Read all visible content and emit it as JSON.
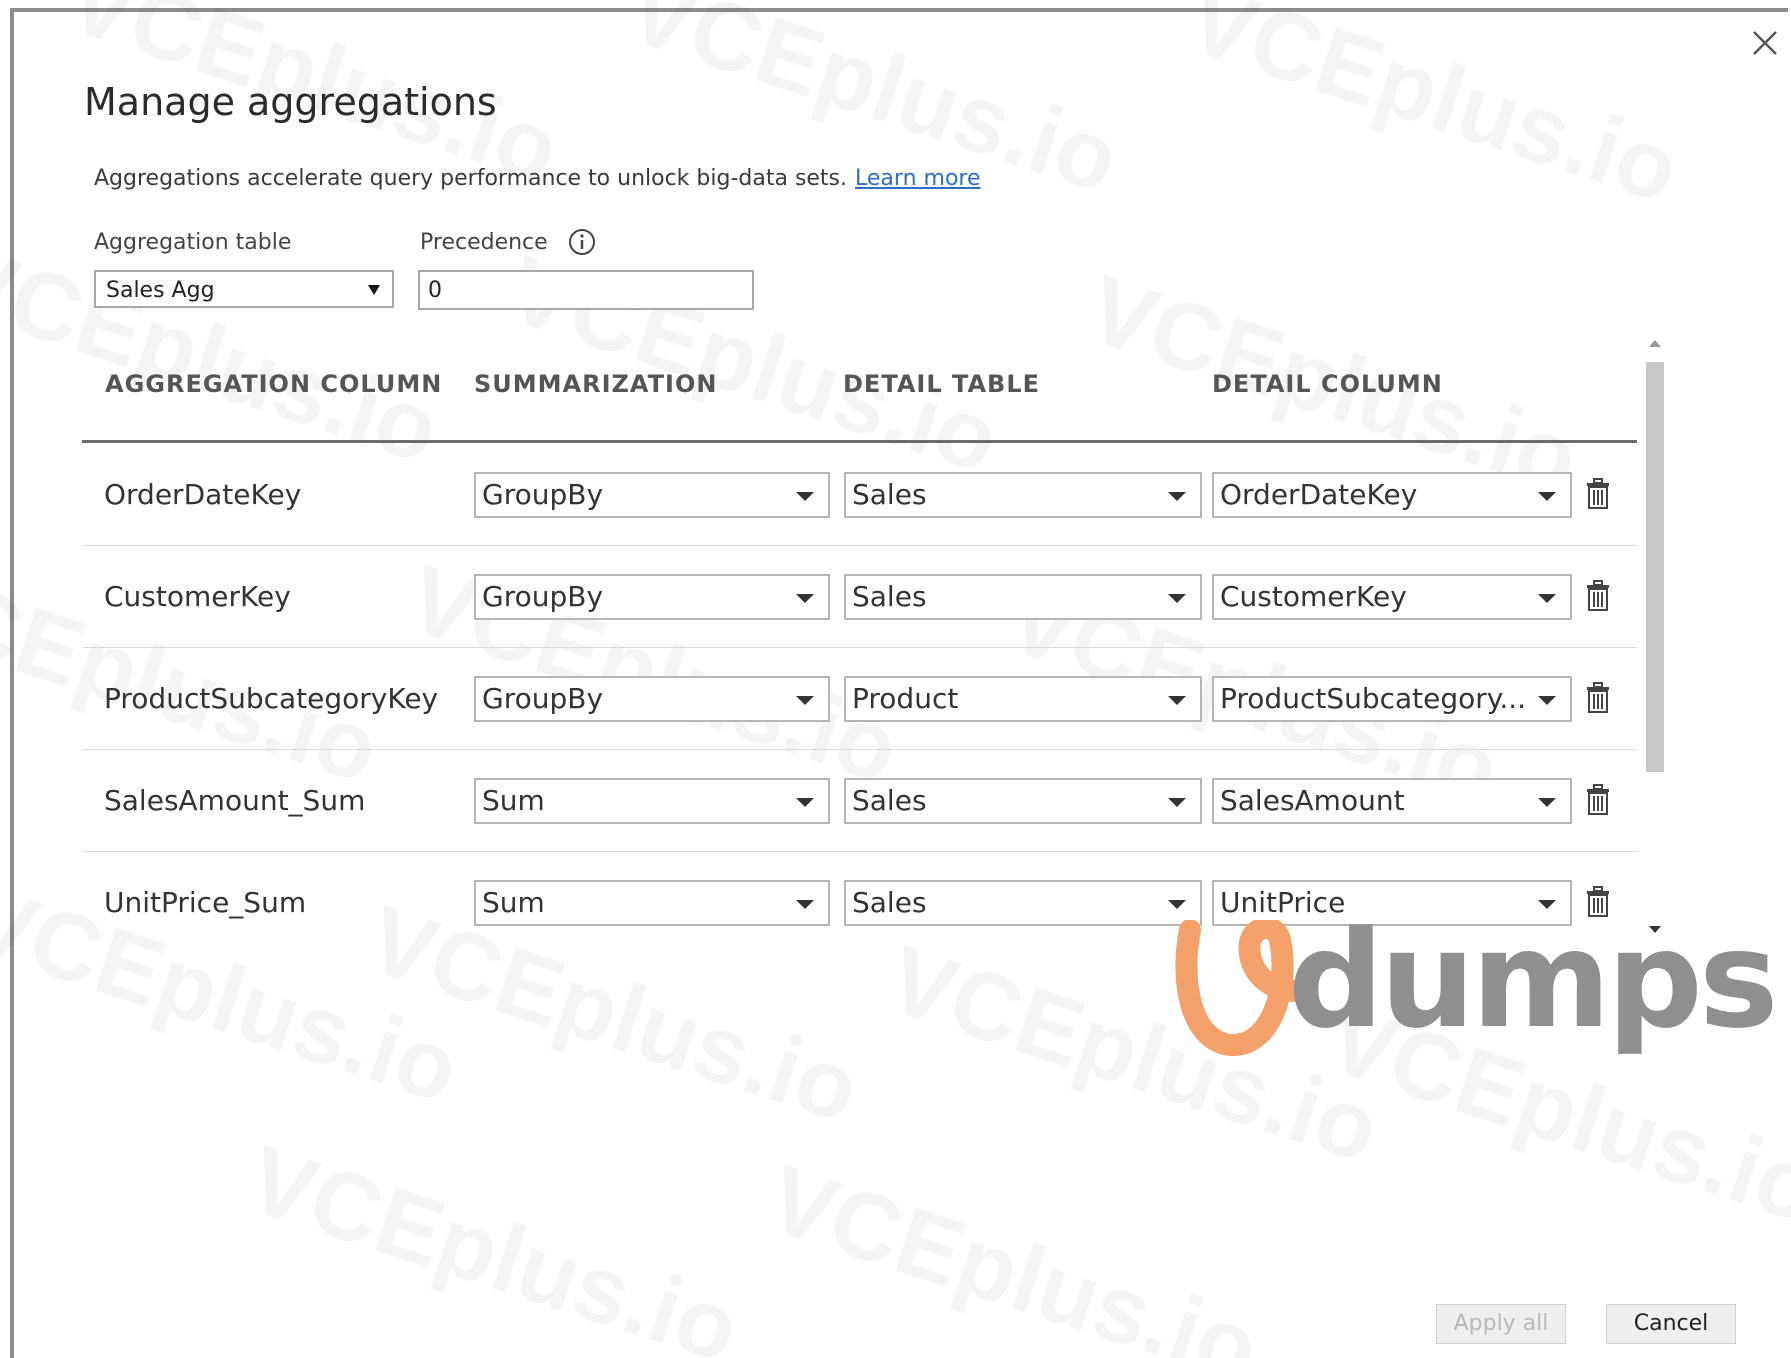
{
  "dialog": {
    "title": "Manage aggregations",
    "description": "Aggregations accelerate query performance to unlock big-data sets.",
    "learn_more": "Learn more"
  },
  "aggregation_table": {
    "label": "Aggregation table",
    "value": "Sales Agg"
  },
  "precedence": {
    "label": "Precedence",
    "value": "0"
  },
  "columns": {
    "aggregation_column": "AGGREGATION COLUMN",
    "summarization": "SUMMARIZATION",
    "detail_table": "DETAIL TABLE",
    "detail_column": "DETAIL COLUMN"
  },
  "rows": [
    {
      "aggregation_column": "OrderDateKey",
      "summarization": "GroupBy",
      "detail_table": "Sales",
      "detail_column": "OrderDateKey"
    },
    {
      "aggregation_column": "CustomerKey",
      "summarization": "GroupBy",
      "detail_table": "Sales",
      "detail_column": "CustomerKey"
    },
    {
      "aggregation_column": "ProductSubcategoryKey",
      "summarization": "GroupBy",
      "detail_table": "Product",
      "detail_column": "ProductSubcategory..."
    },
    {
      "aggregation_column": "SalesAmount_Sum",
      "summarization": "Sum",
      "detail_table": "Sales",
      "detail_column": "SalesAmount"
    },
    {
      "aggregation_column": "UnitPrice_Sum",
      "summarization": "Sum",
      "detail_table": "Sales",
      "detail_column": "UnitPrice"
    }
  ],
  "buttons": {
    "apply_all": "Apply all",
    "cancel": "Cancel"
  },
  "watermark": {
    "text": "VCEplus.io",
    "logo_text": "dumps",
    "logo_color": "#f4a06b",
    "logo_text_color": "#8f8f8f"
  },
  "colors": {
    "link": "#2a6fc9",
    "border": "#b5b5b5",
    "header_rule": "#6b6b6b"
  }
}
